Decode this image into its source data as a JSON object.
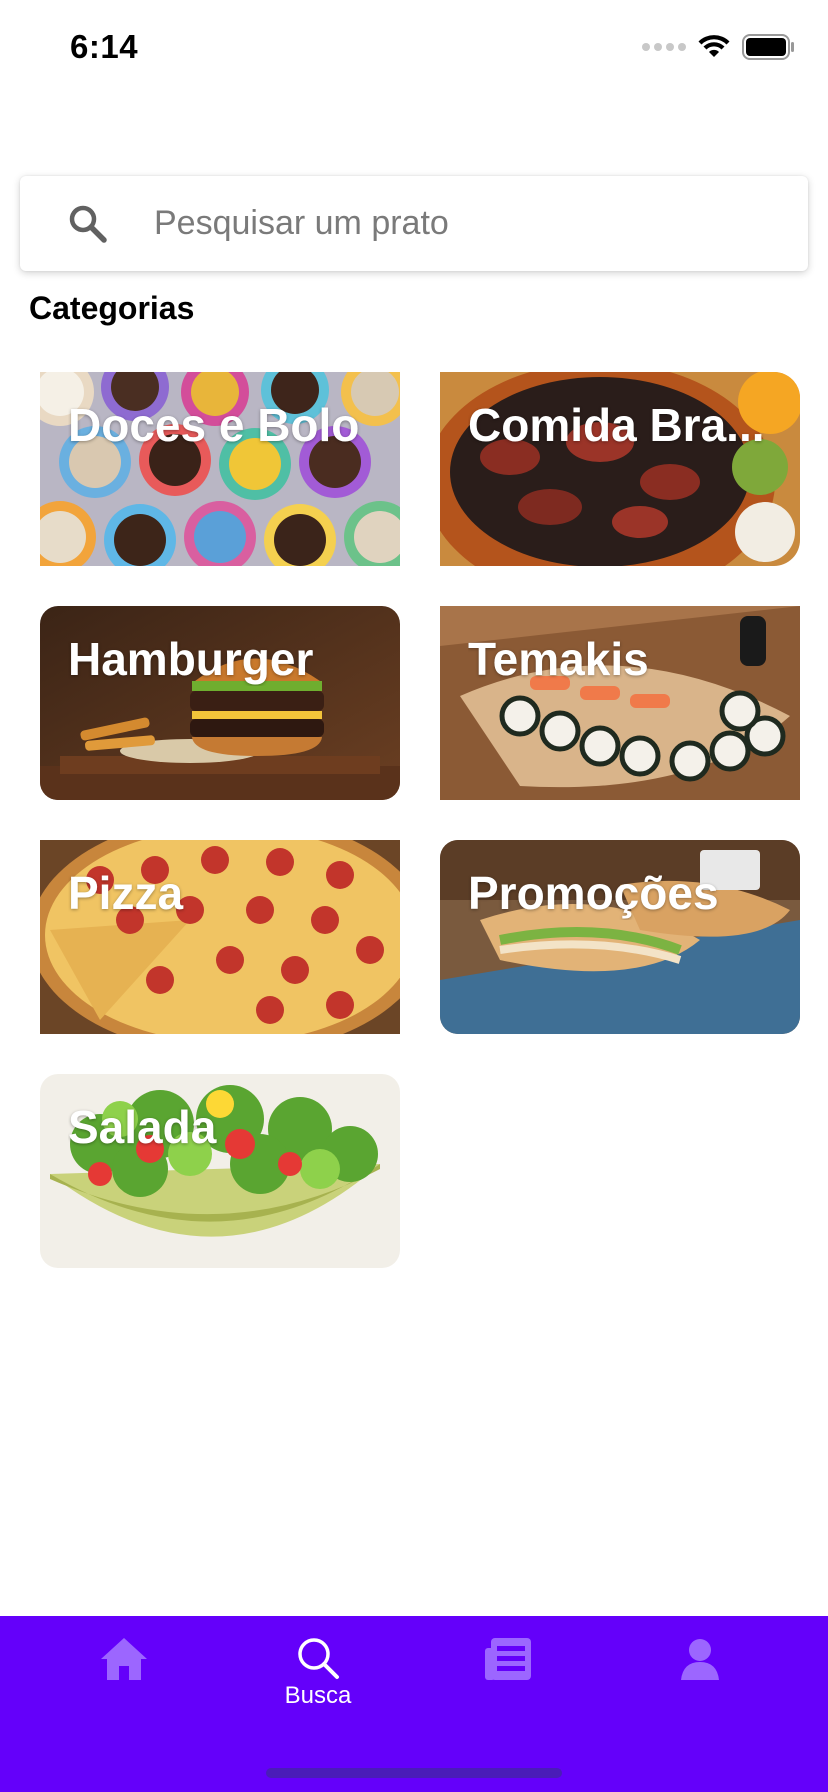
{
  "status_bar": {
    "time": "6:14"
  },
  "search": {
    "placeholder": "Pesquisar um prato",
    "value": ""
  },
  "section": {
    "title": "Categorias"
  },
  "categories": [
    {
      "label": "Doces e Bolo",
      "image": "brigadeiros"
    },
    {
      "label": "Comida Bra...",
      "image": "feijoada"
    },
    {
      "label": "Hamburger",
      "image": "hamburger"
    },
    {
      "label": "Temakis",
      "image": "sushi-boat"
    },
    {
      "label": "Pizza",
      "image": "pepperoni-pizza"
    },
    {
      "label": "Promoções",
      "image": "sandwich"
    },
    {
      "label": "Salada",
      "image": "salad-bowl"
    }
  ],
  "tab_bar": {
    "background": "#6400fa",
    "tabs": [
      {
        "icon": "home-icon",
        "label": "",
        "active": false
      },
      {
        "icon": "search-icon",
        "label": "Busca",
        "active": true
      },
      {
        "icon": "orders-icon",
        "label": "",
        "active": false
      },
      {
        "icon": "profile-icon",
        "label": "",
        "active": false
      }
    ]
  },
  "colors": {
    "accent": "#6400fa",
    "inactive_tab_icon": "#9c66ff",
    "active_tab_icon": "#ffffff"
  }
}
